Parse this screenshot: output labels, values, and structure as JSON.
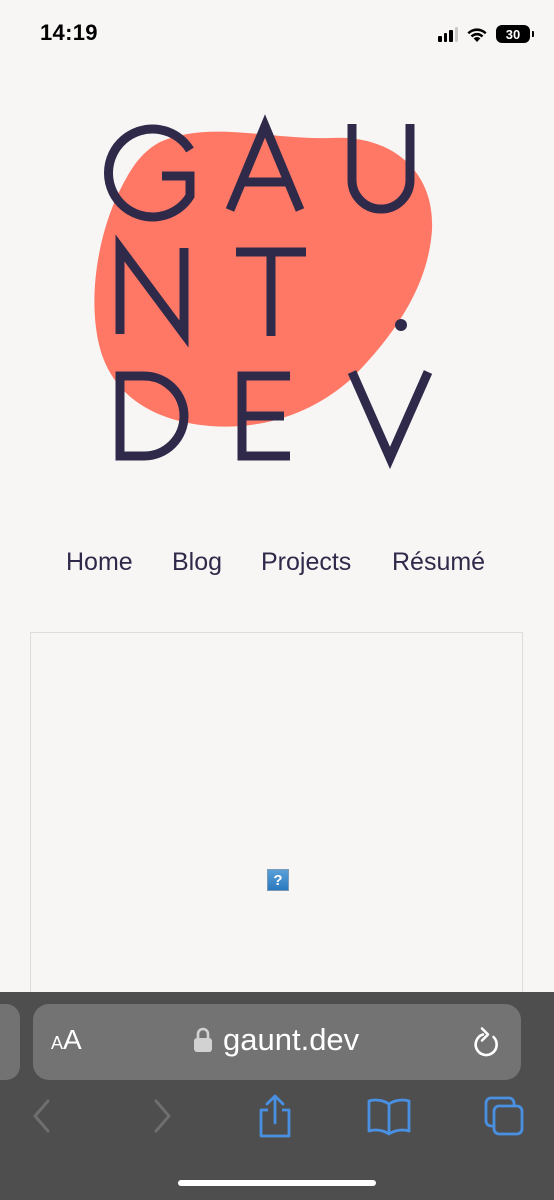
{
  "status_bar": {
    "time": "14:19",
    "battery_level": "30",
    "signal_bars_active": 3,
    "signal_bars_total": 4
  },
  "logo": {
    "line1": "GAUNT",
    "line2": "NT",
    "dot": ".",
    "line3": "DEV",
    "line1_display": "GAU",
    "blob_color": "#ff7866",
    "text_color": "#2f2a4a"
  },
  "nav": {
    "items": [
      {
        "label": "Home"
      },
      {
        "label": "Blog"
      },
      {
        "label": "Projects"
      },
      {
        "label": "Résumé"
      }
    ]
  },
  "content": {
    "broken_image_glyph": "?"
  },
  "browser": {
    "text_size_small": "A",
    "text_size_large": "A",
    "url": "gaunt.dev",
    "icons": [
      "lock-icon",
      "reload-icon",
      "back-icon",
      "forward-icon",
      "share-icon",
      "bookmarks-icon",
      "tabs-icon"
    ],
    "accent_color": "#4a90e2"
  }
}
